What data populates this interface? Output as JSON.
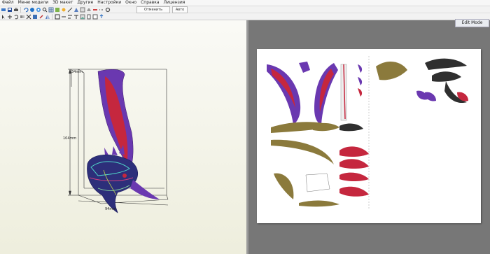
{
  "menubar": {
    "items": [
      "Файл",
      "Меню модели",
      "3D макет",
      "Другие",
      "Настройки",
      "Окно",
      "Справка",
      "Лицензия"
    ]
  },
  "toolbar": {
    "unfold_label": "Отменить",
    "auto_label": "Авто"
  },
  "view3d": {
    "dim_top": "34mm",
    "dim_height": "104mm",
    "dim_width": "94mm"
  },
  "view2d": {
    "mode_label": "Edit Mode"
  },
  "colors": {
    "model_purple": "#7a3fb8",
    "model_red": "#c5273e",
    "part_gold": "#8b7a3c",
    "splitter": "#9a9a9a"
  }
}
